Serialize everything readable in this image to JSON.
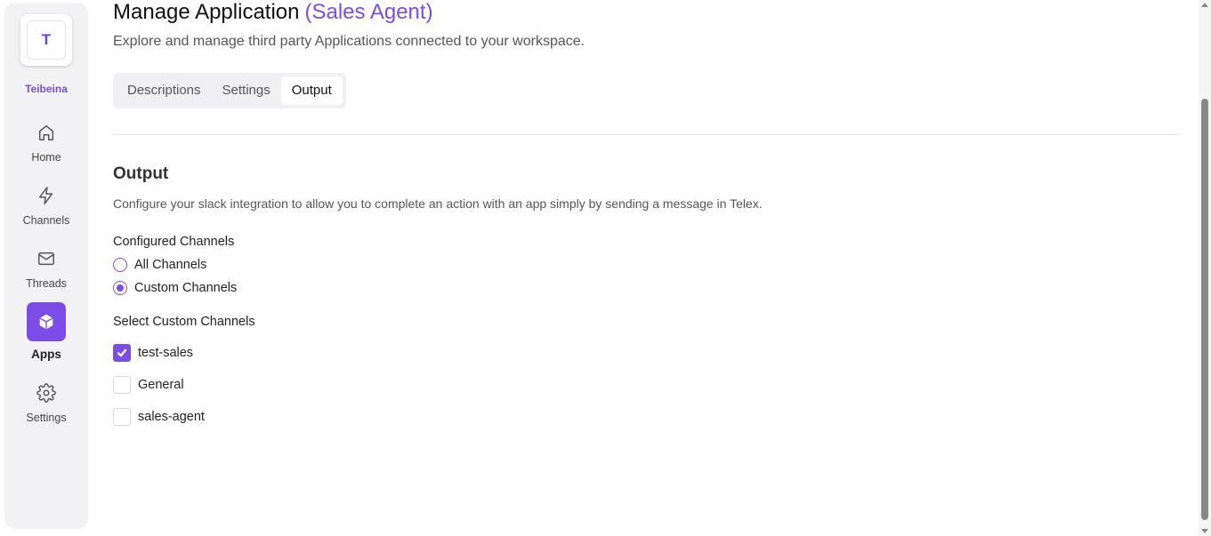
{
  "workspace": {
    "initial": "T",
    "name": "Teibeina"
  },
  "nav": {
    "home": "Home",
    "channels": "Channels",
    "threads": "Threads",
    "apps": "Apps",
    "settings": "Settings"
  },
  "header": {
    "title": "Manage Application",
    "app_name": "(Sales Agent)",
    "subtitle": "Explore and manage third party Applications connected to your workspace."
  },
  "tabs": {
    "descriptions": "Descriptions",
    "settings": "Settings",
    "output": "Output",
    "active": "Output"
  },
  "output": {
    "title": "Output",
    "description": "Configure your slack integration to allow you to complete an action with an app simply by sending a message in Telex.",
    "configured_label": "Configured Channels",
    "radio_all": "All Channels",
    "radio_custom": "Custom Channels",
    "selected_radio": "Custom Channels",
    "select_label": "Select Custom Channels",
    "channels": [
      {
        "name": "test-sales",
        "checked": true
      },
      {
        "name": "General",
        "checked": false
      },
      {
        "name": "sales-agent",
        "checked": false
      }
    ]
  },
  "colors": {
    "accent": "#7b4ce6"
  }
}
